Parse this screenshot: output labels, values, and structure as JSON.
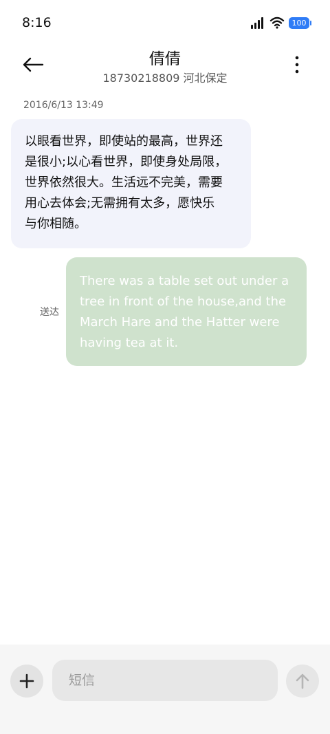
{
  "status_bar": {
    "time": "8:16",
    "battery": "100",
    "icons": [
      "signal-icon",
      "wifi-icon",
      "battery-icon"
    ]
  },
  "header": {
    "contact_name": "倩倩",
    "contact_sub": "18730218809 河北保定",
    "back_icon": "arrow-left-icon",
    "more_icon": "more-vertical-icon"
  },
  "conversation": {
    "timestamp": "2016/6/13 13:49",
    "incoming": {
      "lines": [
        "以眼看世界，即使站的最高，世界还",
        "是很小;以心看世界，即使身处局限，",
        "世界依然很大。生活远不完美，需要",
        "用心去体会;无需拥有太多，愿快乐",
        "与你相随。"
      ]
    },
    "outgoing": {
      "lines": [
        "There was a table set out under a",
        "tree in front of the house,and the",
        "March Hare and the Hatter were",
        "having tea at it."
      ],
      "status": "送达"
    }
  },
  "composer": {
    "placeholder": "短信",
    "plus_icon": "plus-icon",
    "send_icon": "arrow-up-icon"
  },
  "colors": {
    "incoming_bubble": "#f2f3fb",
    "outgoing_bubble": "#cfe2cd",
    "battery": "#2f7cf6"
  }
}
